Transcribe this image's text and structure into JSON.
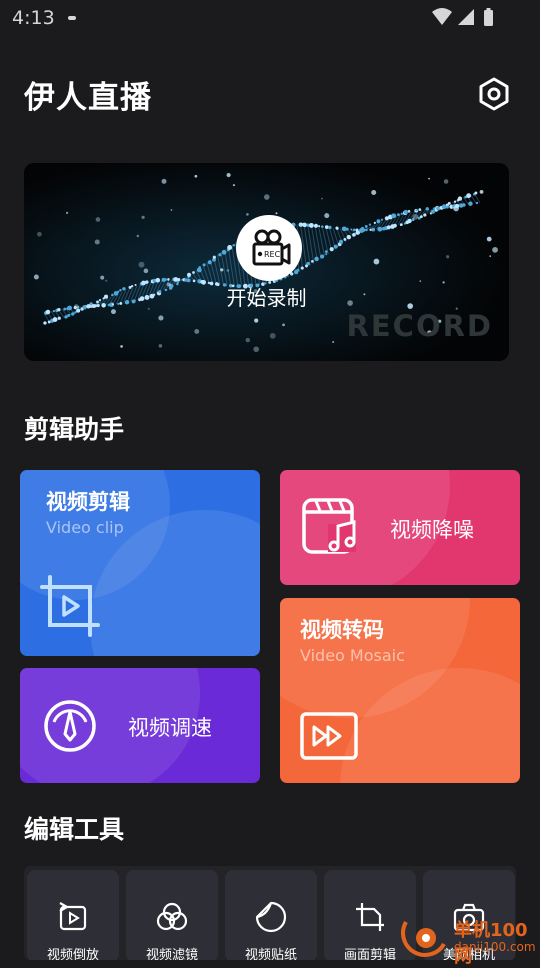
{
  "status": {
    "time": "4:13"
  },
  "header": {
    "title": "伊人直播"
  },
  "banner": {
    "label": "开始录制",
    "watermark": "RECORD",
    "badge": "REC"
  },
  "assistant": {
    "title": "剪辑助手",
    "video_clip": {
      "title": "视频剪辑",
      "subtitle": "Video clip",
      "color": "#2d6fe3"
    },
    "denoise": {
      "title": "视频降噪",
      "color": "#e2366f"
    },
    "transcode": {
      "title": "视频转码",
      "subtitle": "Video Mosaic",
      "color": "#f4673a"
    },
    "speed": {
      "title": "视频调速",
      "color": "#6a2ad8"
    }
  },
  "tools": {
    "title": "编辑工具",
    "items": [
      {
        "label": "视频倒放",
        "icon": "rewind-icon"
      },
      {
        "label": "视频滤镜",
        "icon": "filter-icon"
      },
      {
        "label": "视频贴纸",
        "icon": "sticker-icon"
      },
      {
        "label": "画面剪辑",
        "icon": "crop-icon"
      },
      {
        "label": "美颜相机",
        "icon": "camera-icon"
      }
    ]
  },
  "watermark": {
    "site": "单机100网",
    "url": "danji100.com"
  }
}
